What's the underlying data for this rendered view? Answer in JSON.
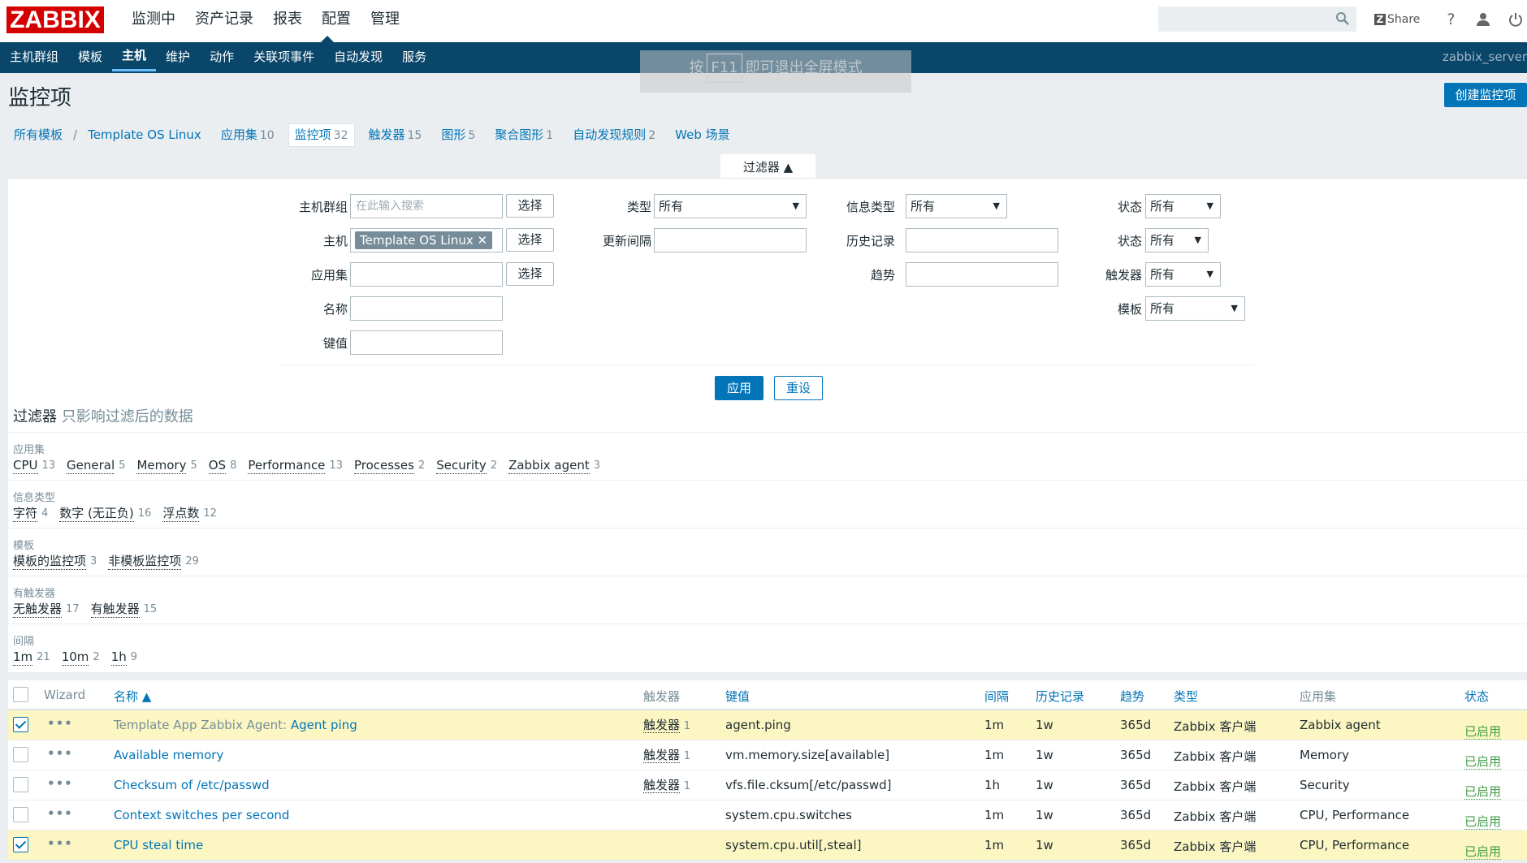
{
  "header": {
    "logo": "ZABBIX",
    "main_nav": [
      "监测中",
      "资产记录",
      "报表",
      "配置",
      "管理"
    ],
    "share_label": "Share",
    "help_label": "?"
  },
  "subnav": {
    "items": [
      "主机群组",
      "模板",
      "主机",
      "维护",
      "动作",
      "关联项事件",
      "自动发现",
      "服务"
    ],
    "server": "zabbix_server"
  },
  "notice": {
    "before": "按",
    "key": "F11",
    "after": "即可退出全屏模式"
  },
  "page": {
    "title": "监控项",
    "create_button": "创建监控项"
  },
  "breadcrumb": {
    "all_templates": "所有模板",
    "sep": "/",
    "template": "Template OS Linux"
  },
  "tabs": [
    {
      "label": "应用集",
      "count": "10"
    },
    {
      "label": "监控项",
      "count": "32"
    },
    {
      "label": "触发器",
      "count": "15"
    },
    {
      "label": "图形",
      "count": "5"
    },
    {
      "label": "聚合图形",
      "count": "1"
    },
    {
      "label": "自动发现规则",
      "count": "2"
    },
    {
      "label": "Web 场景",
      "count": ""
    }
  ],
  "filter": {
    "tab_label": "过滤器 ▲",
    "hostgroup_label": "主机群组",
    "hostgroup_placeholder": "在此输入搜索",
    "select_label": "选择",
    "host_label": "主机",
    "host_tag": "Template OS Linux",
    "app_label": "应用集",
    "name_label": "名称",
    "key_label": "键值",
    "type_label": "类型",
    "type_value": "所有",
    "interval_label": "更新间隔",
    "infotype_label": "信息类型",
    "infotype_value": "所有",
    "history_label": "历史记录",
    "trend_label": "趋势",
    "status_label": "状态",
    "status_value": "所有",
    "state_label": "状态",
    "state_value": "所有",
    "trigger_label": "触发器",
    "trigger_value": "所有",
    "template_label": "模板",
    "template_value": "所有",
    "apply": "应用",
    "reset": "重设"
  },
  "subfilter": {
    "title": "过滤器",
    "note": "只影响过滤后的数据",
    "groups": [
      {
        "label": "应用集",
        "values": [
          {
            "v": "CPU",
            "n": "13"
          },
          {
            "v": "General",
            "n": "5"
          },
          {
            "v": "Memory",
            "n": "5"
          },
          {
            "v": "OS",
            "n": "8"
          },
          {
            "v": "Performance",
            "n": "13"
          },
          {
            "v": "Processes",
            "n": "2"
          },
          {
            "v": "Security",
            "n": "2"
          },
          {
            "v": "Zabbix agent",
            "n": "3"
          }
        ]
      },
      {
        "label": "信息类型",
        "values": [
          {
            "v": "字符",
            "n": "4"
          },
          {
            "v": "数字 (无正负)",
            "n": "16"
          },
          {
            "v": "浮点数",
            "n": "12"
          }
        ]
      },
      {
        "label": "模板",
        "values": [
          {
            "v": "模板的监控项",
            "n": "3"
          },
          {
            "v": "非模板监控项",
            "n": "29"
          }
        ]
      },
      {
        "label": "有触发器",
        "values": [
          {
            "v": "无触发器",
            "n": "17"
          },
          {
            "v": "有触发器",
            "n": "15"
          }
        ]
      },
      {
        "label": "间隔",
        "values": [
          {
            "v": "1m",
            "n": "21"
          },
          {
            "v": "10m",
            "n": "2"
          },
          {
            "v": "1h",
            "n": "9"
          }
        ]
      }
    ]
  },
  "table": {
    "headers": {
      "wizard": "Wizard",
      "name": "名称 ▲",
      "triggers": "触发器",
      "key": "键值",
      "interval": "间隔",
      "history": "历史记录",
      "trends": "趋势",
      "type": "类型",
      "apps": "应用集",
      "status": "状态"
    },
    "rows": [
      {
        "checked": true,
        "name_prefix": "Template App Zabbix Agent: ",
        "name": "Agent ping",
        "triggers": "触发器",
        "trig_count": "1",
        "key": "agent.ping",
        "interval": "1m",
        "history": "1w",
        "trends": "365d",
        "type": "Zabbix 客户端",
        "apps": "Zabbix agent",
        "status": "已启用"
      },
      {
        "checked": false,
        "name_prefix": "",
        "name": "Available memory",
        "triggers": "触发器",
        "trig_count": "1",
        "key": "vm.memory.size[available]",
        "interval": "1m",
        "history": "1w",
        "trends": "365d",
        "type": "Zabbix 客户端",
        "apps": "Memory",
        "status": "已启用"
      },
      {
        "checked": false,
        "name_prefix": "",
        "name": "Checksum of /etc/passwd",
        "triggers": "触发器",
        "trig_count": "1",
        "key": "vfs.file.cksum[/etc/passwd]",
        "interval": "1h",
        "history": "1w",
        "trends": "365d",
        "type": "Zabbix 客户端",
        "apps": "Security",
        "status": "已启用"
      },
      {
        "checked": false,
        "name_prefix": "",
        "name": "Context switches per second",
        "triggers": "",
        "trig_count": "",
        "key": "system.cpu.switches",
        "interval": "1m",
        "history": "1w",
        "trends": "365d",
        "type": "Zabbix 客户端",
        "apps": "CPU, Performance",
        "status": "已启用"
      },
      {
        "checked": true,
        "name_prefix": "",
        "name": "CPU steal time",
        "triggers": "",
        "trig_count": "",
        "key": "system.cpu.util[,steal]",
        "interval": "1m",
        "history": "1w",
        "trends": "365d",
        "type": "Zabbix 客户端",
        "apps": "CPU, Performance",
        "status": "已启用"
      }
    ]
  },
  "colors": {
    "brand": "#d40000",
    "subnav": "#0a466a",
    "link": "#0275b8",
    "highlight": "#fcf7c2",
    "enabled": "#429e47"
  }
}
